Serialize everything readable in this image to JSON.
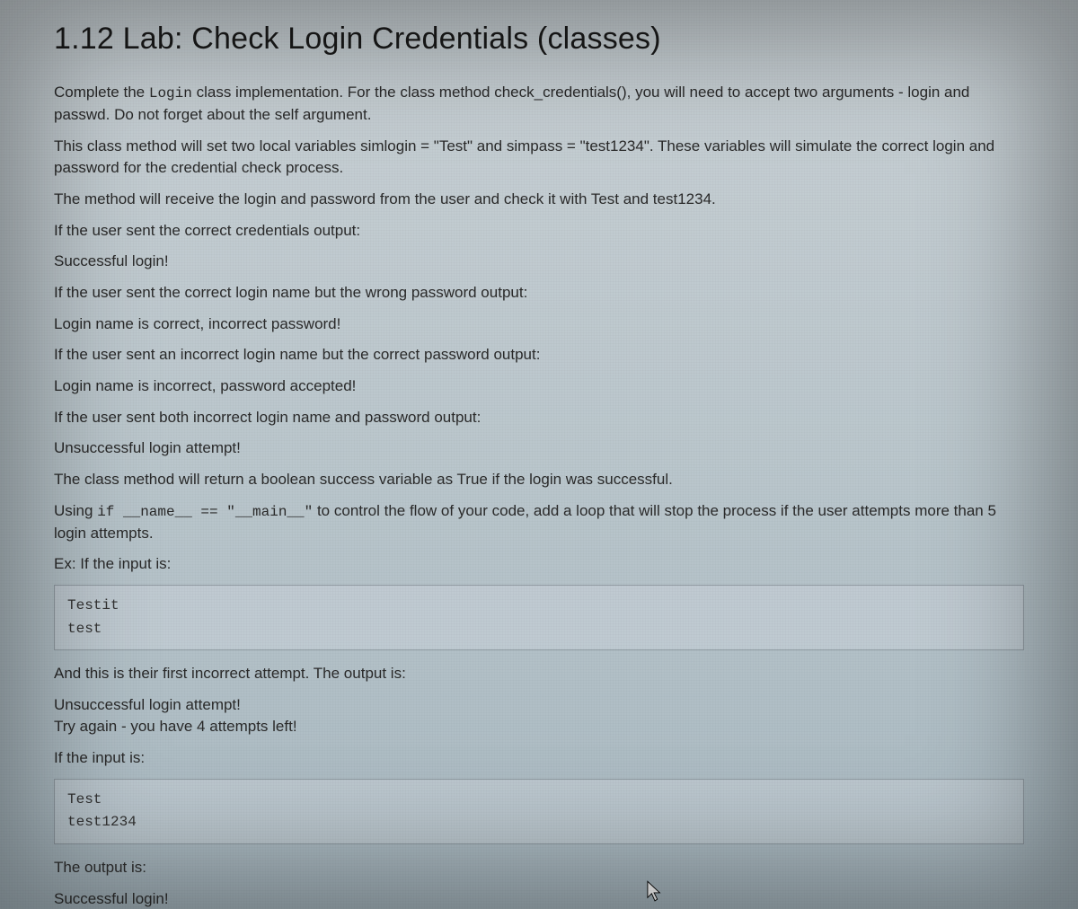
{
  "title": "1.12 Lab: Check Login Credentials (classes)",
  "p1_a": "Complete the ",
  "p1_code": "Login",
  "p1_b": " class implementation. For the class method check_credentials(), you will need to accept two arguments - login and passwd. Do not forget about the self argument.",
  "p2": "This class method will set two local variables simlogin = \"Test\" and simpass = \"test1234\". These variables will simulate the correct login and password for the credential check process.",
  "p3": "The method will receive the login and password from the user and check it with Test and test1234.",
  "p4": "If the user sent the correct credentials output:",
  "p5": "Successful login!",
  "p6": "If the user sent the correct login name but the wrong password output:",
  "p7": "Login name is correct, incorrect password!",
  "p8": "If the user sent an incorrect login name but the correct password output:",
  "p9": "Login name is incorrect, password accepted!",
  "p10": "If the user sent both incorrect login name and password output:",
  "p11": "Unsuccessful login attempt!",
  "p12": "The class method will return a boolean success variable as True if the login was successful.",
  "p13_a": "Using ",
  "p13_code": "if __name__ == \"__main__\"",
  "p13_b": " to control the flow of your code, add a loop that will stop the process if the user attempts more than 5 login attempts.",
  "p14": "Ex: If the input is:",
  "code1": "Testit\ntest",
  "p15": "And this is their first incorrect attempt. The output is:",
  "p16": "Unsuccessful login attempt!\nTry again - you have 4 attempts left!",
  "p17": "If the input is:",
  "code2": "Test\ntest1234",
  "p18": "The output is:",
  "p19": "Successful login!"
}
